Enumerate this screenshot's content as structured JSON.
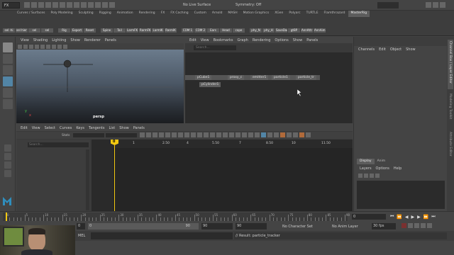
{
  "status": {
    "mode": "FX",
    "live_surface": "No Live Surface",
    "symmetry": "Symmetry: Off",
    "workspace": "MasterRig"
  },
  "shelf_tabs": [
    "Curves / Surfaces",
    "Poly Modeling",
    "Sculpting",
    "Rigging",
    "Animation",
    "Rendering",
    "FX",
    "FX Caching",
    "Custom",
    "Arnold",
    "MASH",
    "Motion Graphics",
    "XGen",
    "Polyarc",
    "TURTLE",
    "Flamthrazard",
    "MasterRig"
  ],
  "shelf_buttons": [
    "sel -hi",
    "sel hier",
    "sel Lhar",
    "sel Rhar",
    "Rig",
    "Export",
    "Reset",
    "Spine",
    "Tail",
    "LarmFK",
    "RarmFK",
    "LarmIK",
    "RarmIK",
    "COM 1",
    "COM 2",
    "Ears",
    "Head",
    "cape",
    "phy_N",
    "phy_H",
    "SaveDag",
    "gtBP",
    "AnnAttr",
    "AnnAim"
  ],
  "viewport": {
    "menu": [
      "View",
      "Shading",
      "Lighting",
      "Show",
      "Renderer",
      "Panels"
    ],
    "camera_label": "persp"
  },
  "outliner": {
    "menu": [
      "Edit",
      "View",
      "Bookmarks",
      "Graph",
      "Rendering",
      "Options",
      "Show",
      "Panels"
    ],
    "search_placeholder": "Search...",
    "nodes": [
      "pCube1",
      "proxy_c",
      "emitter1",
      "particle1",
      "particle_tr",
      "pCylinder1"
    ]
  },
  "channel_box": {
    "menu": [
      "Channels",
      "Edit",
      "Object",
      "Show"
    ],
    "side_tabs": [
      "Channel Box / Layer Editor",
      "Modeling Toolkit",
      "Attribute Editor"
    ]
  },
  "graph_editor": {
    "menu": [
      "Edit",
      "View",
      "Select",
      "Curves",
      "Keys",
      "Tangents",
      "List",
      "Show",
      "Panels"
    ],
    "stats_label": "Stats",
    "search_placeholder": "Search...",
    "current_frame_badge": "0",
    "ruler_labels": [
      "0",
      "1",
      "2.50",
      "4",
      "5.50",
      "7",
      "8.50",
      "10",
      "11.50"
    ]
  },
  "display_panel": {
    "tabs": [
      "Display",
      "Anim"
    ],
    "menu": [
      "Layers",
      "Options",
      "Help"
    ]
  },
  "timeline": {
    "tick_labels": [
      "0",
      "5",
      "10",
      "15",
      "20",
      "25",
      "30",
      "35",
      "40",
      "45",
      "50",
      "55",
      "60",
      "65",
      "70",
      "75",
      "80",
      "85",
      "90"
    ],
    "current_frame": "0"
  },
  "range": {
    "start": "0",
    "start_inner": "0",
    "end_inner": "90",
    "end": "90",
    "end_outer": "90",
    "character_set": "No Character Set",
    "anim_layer": "No Anim Layer",
    "fps": "30 fps"
  },
  "command_line": {
    "label": "MEL",
    "result": "// Result: particle_tracker"
  },
  "colors": {
    "playhead": "#f2c811",
    "accent": "#5285a6",
    "panel_dark": "#2b2b2b",
    "panel_mid": "#444444"
  }
}
